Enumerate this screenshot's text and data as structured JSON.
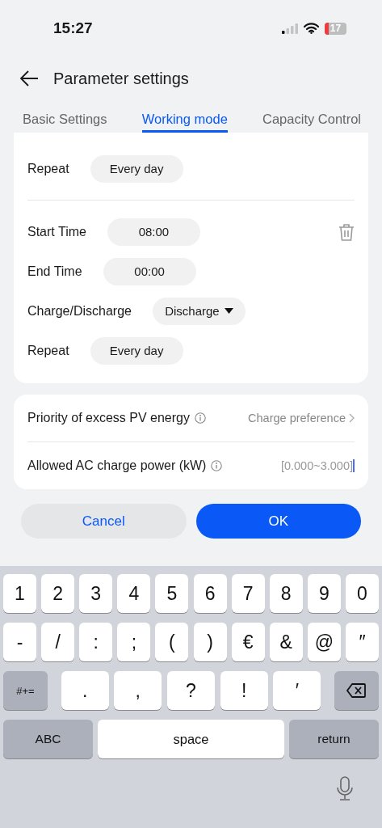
{
  "status_bar": {
    "time": "15:27",
    "battery": "17"
  },
  "header": {
    "title": "Parameter settings"
  },
  "tabs": [
    {
      "label": "Basic Settings",
      "selected": false
    },
    {
      "label": "Working mode",
      "selected": true
    },
    {
      "label": "Capacity Control",
      "selected": false
    }
  ],
  "schedule": [
    {
      "deletable": false,
      "rows": [
        {
          "label": "Repeat",
          "value": "Every day",
          "kind": "pill"
        }
      ]
    },
    {
      "deletable": true,
      "rows": [
        {
          "label": "Start Time",
          "value": "08:00",
          "kind": "pill"
        },
        {
          "label": "End Time",
          "value": "00:00",
          "kind": "pill"
        },
        {
          "label": "Charge/Discharge",
          "value": "Discharge",
          "kind": "dropdown"
        },
        {
          "label": "Repeat",
          "value": "Every day",
          "kind": "pill"
        }
      ]
    }
  ],
  "settings": [
    {
      "label": "Priority of excess PV energy",
      "info": true,
      "value": "Charge preference",
      "kind": "select"
    },
    {
      "label": "Allowed AC charge power (kW)",
      "info": true,
      "placeholder": "[0.000~3.000]",
      "kind": "input"
    }
  ],
  "buttons": [
    {
      "label": "Cancel",
      "kind": "secondary"
    },
    {
      "label": "OK",
      "kind": "primary"
    }
  ],
  "keyboard": [
    [
      {
        "label": "1",
        "kind": "char"
      },
      {
        "label": "2",
        "kind": "char"
      },
      {
        "label": "3",
        "kind": "char"
      },
      {
        "label": "4",
        "kind": "char"
      },
      {
        "label": "5",
        "kind": "char"
      },
      {
        "label": "6",
        "kind": "char"
      },
      {
        "label": "7",
        "kind": "char"
      },
      {
        "label": "8",
        "kind": "char"
      },
      {
        "label": "9",
        "kind": "char"
      },
      {
        "label": "0",
        "kind": "char"
      }
    ],
    [
      {
        "label": "-",
        "kind": "char"
      },
      {
        "label": "/",
        "kind": "char"
      },
      {
        "label": ":",
        "kind": "char"
      },
      {
        "label": ";",
        "kind": "char"
      },
      {
        "label": "(",
        "kind": "char"
      },
      {
        "label": ")",
        "kind": "char"
      },
      {
        "label": "€",
        "kind": "char"
      },
      {
        "label": "&",
        "kind": "char"
      },
      {
        "label": "@",
        "kind": "char"
      },
      {
        "label": "″",
        "kind": "char"
      }
    ],
    [
      {
        "label": "#+=",
        "kind": "function"
      },
      {
        "label": ".",
        "kind": "wide"
      },
      {
        "label": ",",
        "kind": "wide"
      },
      {
        "label": "?",
        "kind": "wide"
      },
      {
        "label": "!",
        "kind": "wide"
      },
      {
        "label": "′",
        "kind": "wide"
      },
      {
        "kind": "delete"
      }
    ],
    [
      {
        "label": "ABC",
        "kind": "bottom"
      },
      {
        "label": "space",
        "kind": "space"
      },
      {
        "label": "return",
        "kind": "bottom"
      }
    ]
  ]
}
